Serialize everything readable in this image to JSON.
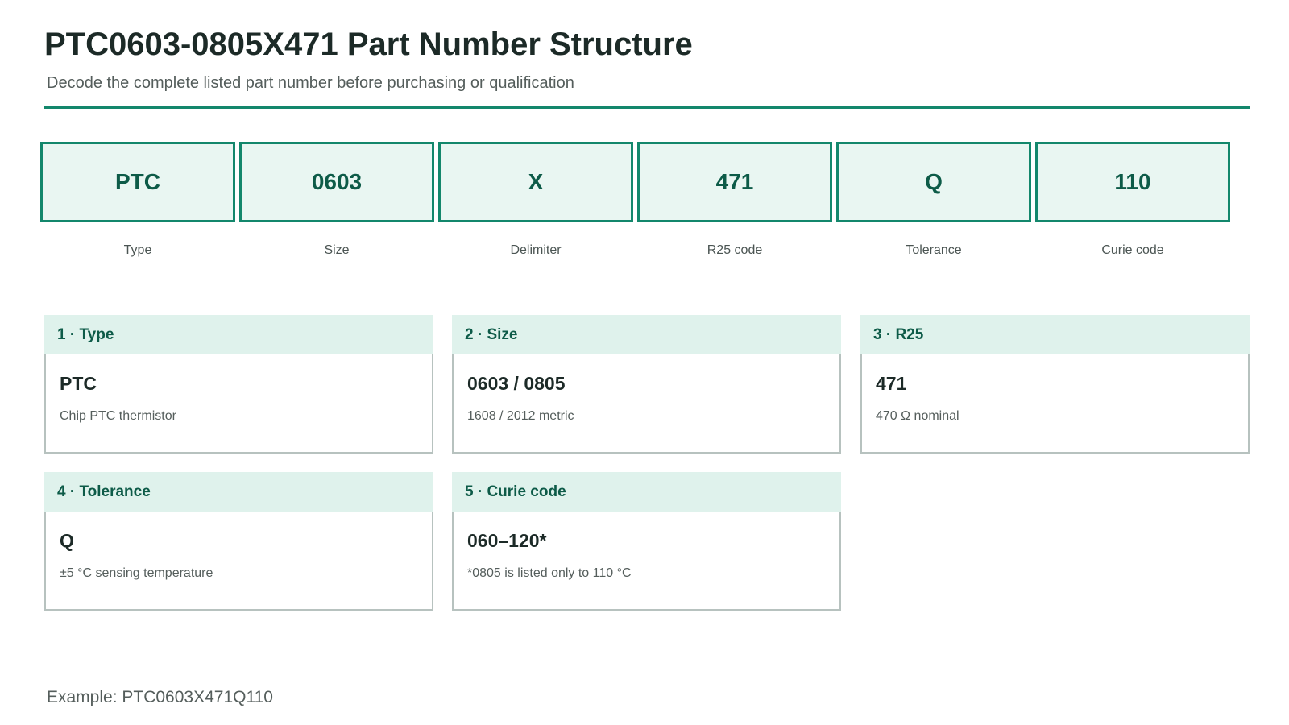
{
  "header": {
    "title": "PTC0603-0805X471 Part Number Structure",
    "subtitle": "Decode the complete listed part number before purchasing or qualification"
  },
  "segments": [
    {
      "code": "PTC",
      "label": "Type"
    },
    {
      "code": "0603",
      "label": "Size"
    },
    {
      "code": "X",
      "label": "Delimiter"
    },
    {
      "code": "471",
      "label": "R25 code"
    },
    {
      "code": "Q",
      "label": "Tolerance"
    },
    {
      "code": "110",
      "label": "Curie code"
    }
  ],
  "cards": [
    {
      "heading": "1 · Type",
      "value": "PTC",
      "description": "Chip PTC thermistor"
    },
    {
      "heading": "2 · Size",
      "value": "0603 / 0805",
      "description": "1608 / 2012 metric"
    },
    {
      "heading": "3 · R25",
      "value": "471",
      "description": "470 Ω nominal"
    },
    {
      "heading": "4 · Tolerance",
      "value": "Q",
      "description": "±5 °C sensing temperature"
    },
    {
      "heading": "5 · Curie code",
      "value": "060–120*",
      "description": "*0805 is listed only to 110 °C"
    }
  ],
  "footer": {
    "example": "Example: PTC0603X471Q110"
  },
  "colors": {
    "accent": "#13876c",
    "segment_fill": "#e9f6f2",
    "card_header_fill": "#dff2ec",
    "heading_text": "#0d5b48"
  }
}
